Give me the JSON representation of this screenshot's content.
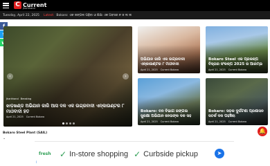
{
  "header": {
    "brand": "Current",
    "brand_sub": "Jharkhand",
    "date": "Tuesday, April 22, 2025",
    "latest_label": "Latest:",
    "latest_text": "Bokaro: ଏକ ଜଙ୍ଗଲ ପଢ଼ିବା ଓ ଶିକ୍ଷା ଏକ ଅବସର ନ ଜ ଲ ଲ"
  },
  "social": {
    "facebook": "f",
    "twitter": "t",
    "whatsapp": "w",
    "toggle": "‹"
  },
  "main_story": {
    "categories": [
      "Jharkhand",
      "Breaking"
    ],
    "title": "ଝାଡ଼ଖଣ୍ଡ ଅଭିଯାନ ଜାରି ଆସ ଦଳ ଏକ ଉଗ୍ରବାଦୀ ଏନ୍କାଉଣ୍ଟର ୮ ମାଓବାଦୀ ହତ",
    "date": "April 21, 2025",
    "author": "Current Bokaro"
  },
  "stories": [
    {
      "title": "ଅଭିଯାନ ଜାରି ଏକ ଉଗ୍ରବାଦୀ ଏନ୍କାଉଣ୍ଟର ୮ ମାଓବାଦୀ",
      "date": "April 21, 2025",
      "author": "Current Bokaro"
    },
    {
      "title": "Bokaro Steel ଏକ ପ୍ରକଳ୍ପ ବିସ୍ତାର ସଂକଳ୍ପ 2025 ର ଆରମ୍ଭ",
      "date": "April 21, 2025",
      "author": "Current Bokaro"
    },
    {
      "title": "Bokaro: ବନ ବିଭାଗ ଜଙ୍ଗଲ ସୁରକ୍ଷା ଅଭିଯାନ ନେତାଙ୍କ ଦଳ ସହ",
      "date": "April 21, 2025",
      "author": "Current Bokaro"
    },
    {
      "title": "Bokaro: ସଡ଼କ ଦୁର୍ଘଟଣା ପ୍ରଶାସନ ସତର୍କ ଦଳ ପହଞ୍ଚିଲା",
      "date": "April 21, 2025",
      "author": "Current Bokaro"
    }
  ],
  "section": {
    "label": "Bokaro Steel Plant (SAIL)"
  },
  "ad": {
    "brand": "fresh",
    "items": [
      "In-store shopping",
      "Curbside pickup"
    ],
    "info": "i"
  },
  "colors": {
    "accent": "#e02020",
    "topbar": "#000000",
    "ad_check": "#2e9e54"
  }
}
